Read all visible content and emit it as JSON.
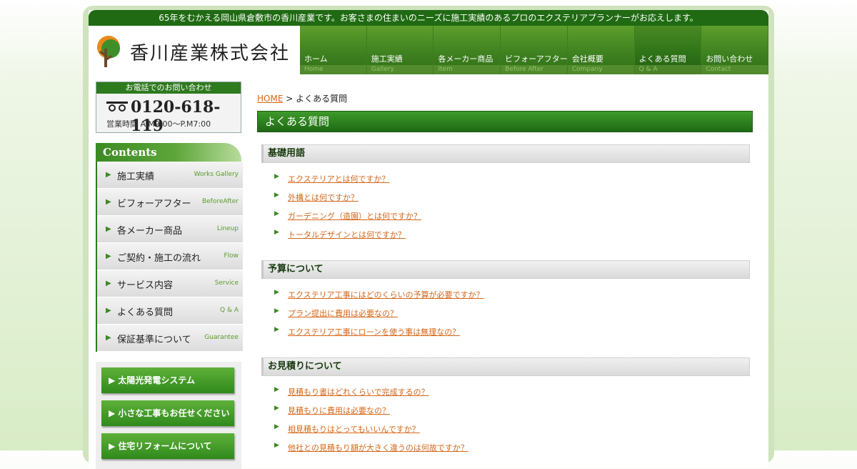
{
  "header": {
    "tagline": "65年をむかえる岡山県倉敷市の香川産業です。お客さまの住まいのニーズに施工実績のあるプロのエクステリアプランナーがお応えします。",
    "company_name": "香川産業株式会社"
  },
  "nav": [
    {
      "jp": "ホーム",
      "en": "Home"
    },
    {
      "jp": "施工実績",
      "en": "Gallery"
    },
    {
      "jp": "各メーカー商品",
      "en": "Item"
    },
    {
      "jp": "ビフォーアフター",
      "en": "Before After"
    },
    {
      "jp": "会社概要",
      "en": "Company"
    },
    {
      "jp": "よくある質問",
      "en": "Q & A"
    },
    {
      "jp": "お問い合わせ",
      "en": "Contact"
    }
  ],
  "contact": {
    "heading": "お電話でのお問い合わせ",
    "phone": "0120-618-119",
    "hours": "営業時間 A.M9:00～P.M7:00"
  },
  "sidebar": {
    "contents_title": "Contents",
    "items": [
      {
        "jp": "施工実績",
        "en": "Works Gallery"
      },
      {
        "jp": "ビフォーアフター",
        "en": "BeforeAfter"
      },
      {
        "jp": "各メーカー商品",
        "en": "Lineup"
      },
      {
        "jp": "ご契約・施工の流れ",
        "en": "Flow"
      },
      {
        "jp": "サービス内容",
        "en": "Service"
      },
      {
        "jp": "よくある質問",
        "en": "Q & A"
      },
      {
        "jp": "保証基準について",
        "en": "Guarantee"
      }
    ],
    "banners": [
      "太陽光発電システム",
      "小さな工事もお任せください",
      "住宅リフォームについて"
    ]
  },
  "breadcrumb": {
    "home": "HOME",
    "separator": ">",
    "current": "よくある質問"
  },
  "page_title": "よくある質問",
  "sections": [
    {
      "title": "基礎用語",
      "questions": [
        "エクステリアとは何ですか？",
        "外構とは何ですか？",
        "ガーデニング（造園）とは何ですか？",
        "トータルデザインとは何ですか？"
      ]
    },
    {
      "title": "予算について",
      "questions": [
        "エクステリア工事にはどのくらいの予算が必要ですか？",
        "プラン提出に費用は必要なの？",
        "エクステリア工事にローンを使う事は無理なの？"
      ]
    },
    {
      "title": "お見積りについて",
      "questions": [
        "見積もり書はどれくらいで完成するの？",
        "見積もりに費用は必要なの？",
        "相見積もりはとってもいいんですか？",
        "他社との見積もり額が大きく違うのは何故ですか？"
      ]
    }
  ],
  "colors": {
    "brand_green": "#2e7a1e",
    "link_orange": "#d4671a"
  }
}
